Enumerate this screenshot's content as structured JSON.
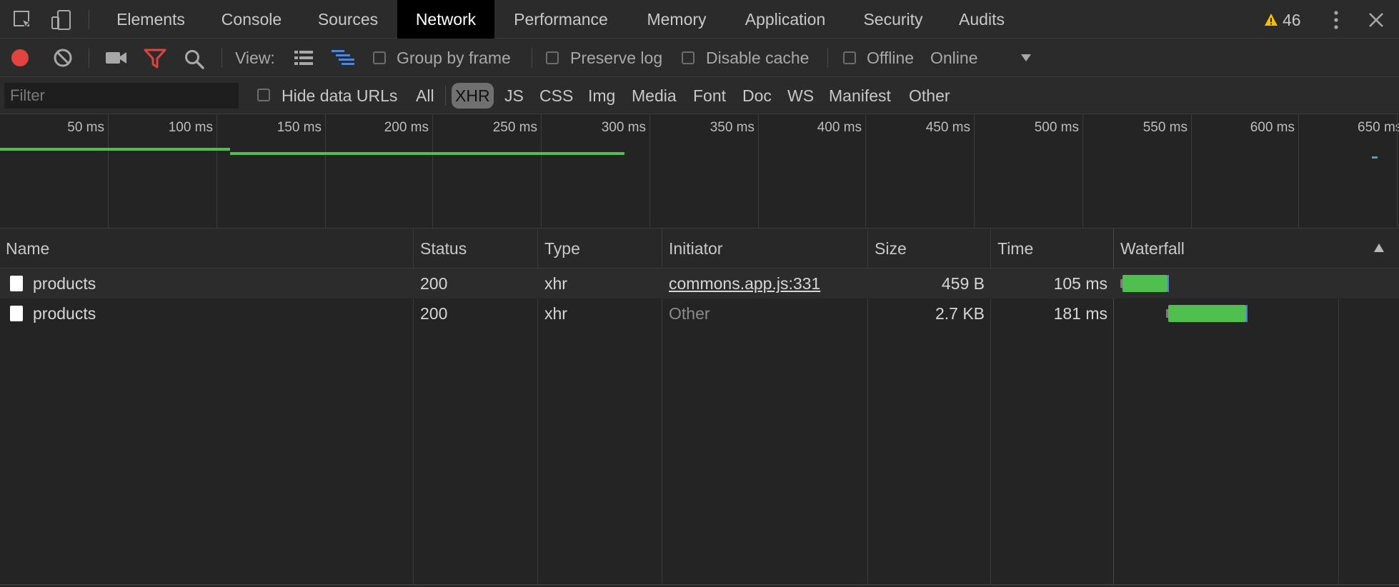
{
  "tabs": [
    {
      "label": "Elements"
    },
    {
      "label": "Console"
    },
    {
      "label": "Sources"
    },
    {
      "label": "Network",
      "active": true
    },
    {
      "label": "Performance"
    },
    {
      "label": "Memory"
    },
    {
      "label": "Application"
    },
    {
      "label": "Security"
    },
    {
      "label": "Audits"
    }
  ],
  "warnings": {
    "count": "46",
    "icon": "warning-icon"
  },
  "toolbar": {
    "view_label": "View:",
    "group_by_frame": "Group by frame",
    "preserve_log": "Preserve log",
    "disable_cache": "Disable cache",
    "offline": "Offline",
    "throttling": "Online"
  },
  "filter": {
    "placeholder": "Filter",
    "hide_data_urls": "Hide data URLs",
    "types": [
      "All",
      "XHR",
      "JS",
      "CSS",
      "Img",
      "Media",
      "Font",
      "Doc",
      "WS",
      "Manifest",
      "Other"
    ],
    "active_type": "XHR"
  },
  "overview": {
    "ticks": [
      "50 ms",
      "100 ms",
      "150 ms",
      "200 ms",
      "250 ms",
      "300 ms",
      "350 ms",
      "400 ms",
      "450 ms",
      "500 ms",
      "550 ms",
      "600 ms",
      "650 ms"
    ]
  },
  "table": {
    "columns": [
      "Name",
      "Status",
      "Type",
      "Initiator",
      "Size",
      "Time",
      "Waterfall"
    ],
    "rows": [
      {
        "name": "products",
        "status": "200",
        "type": "xhr",
        "initiator": "commons.app.js:331",
        "initiator_link": true,
        "size": "459 B",
        "time": "105 ms"
      },
      {
        "name": "products",
        "status": "200",
        "type": "xhr",
        "initiator": "Other",
        "initiator_link": false,
        "size": "2.7 KB",
        "time": "181 ms"
      }
    ]
  },
  "colors": {
    "record": "#e0443e",
    "filter_active": "#e0443e",
    "bar": "#4fc04f",
    "warning": "#f4bd00"
  }
}
